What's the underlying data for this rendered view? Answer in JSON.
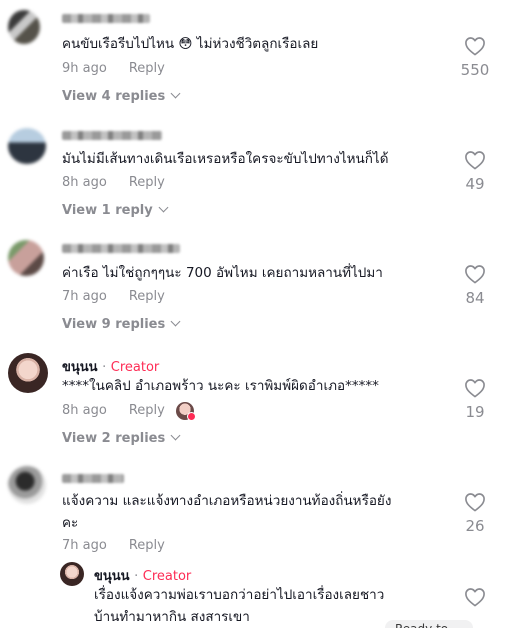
{
  "comments": [
    {
      "text": "คนขับเรือรีบไปไหน 😳 ไม่ห่วงชีวิตลูกเรือเลย",
      "time": "9h ago",
      "reply_label": "Reply",
      "likes": "550",
      "view_replies": "View 4 replies"
    },
    {
      "text": "มันไม่มีเส้นทางเดินเรือเหรอหรือใครจะขับไปทางไหนก็ได้",
      "time": "8h ago",
      "reply_label": "Reply",
      "likes": "49",
      "view_replies": "View 1 reply"
    },
    {
      "text": "ค่าเรือ ไม่ใช่ถูกๆๆนะ 700 อัพไหม เคยถามหลานที่ไปมา",
      "time": "7h ago",
      "reply_label": "Reply",
      "likes": "84",
      "view_replies": "View 9 replies"
    },
    {
      "username": "ขนุนน",
      "separator": "·",
      "badge": "Creator",
      "text": "****ในคลิป อำเภอพร้าว นะคะ เราพิมพ์ผิดอำเภอ*****",
      "time": "8h ago",
      "reply_label": "Reply",
      "likes": "19",
      "view_replies": "View 2 replies"
    },
    {
      "text_line1": "แจ้งความ และแจ้งทางอำเภอหรือหน่วยงานท้องถิ่นหรือยัง",
      "text_line2": "คะ",
      "time": "7h ago",
      "reply_label": "Reply",
      "likes": "26"
    }
  ],
  "reply": {
    "username": "ขนุนน",
    "separator": "·",
    "badge": "Creator",
    "text_line1": "เรื่องแจ้งความพ่อเราบอกว่าอย่าไปเอาเรื่องเลยชาว",
    "text_line2": "บ้านทำมาหากิน สงสารเขา"
  },
  "overlay_text": "Ready to ..."
}
